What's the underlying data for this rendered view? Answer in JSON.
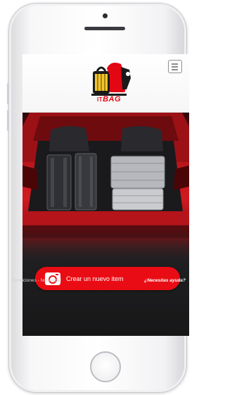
{
  "app": {
    "logo_line1": "IT",
    "logo_line2": "BAG"
  },
  "header": {
    "menu_icon": "hamburger-menu-icon"
  },
  "hero": {
    "image": "red-car-trunk-with-luggage",
    "accent": "#d11a20"
  },
  "cta": {
    "label": "Crear un nuevo item",
    "icon": "camera-icon",
    "color": "#ea0c14"
  },
  "footer": {
    "legal": "Condiciones - Nota legal",
    "help": "¿Necesitas ayuda?"
  }
}
